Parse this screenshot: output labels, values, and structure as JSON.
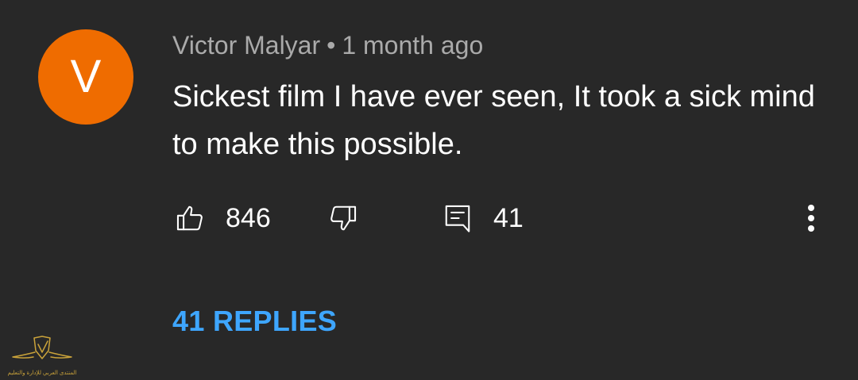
{
  "comment": {
    "avatar_letter": "V",
    "avatar_color": "#ef6c00",
    "author": "Victor Malyar",
    "separator": "•",
    "time": "1 month ago",
    "text": "Sickest film I have ever seen, It took a sick mind to make this possible.",
    "likes": "846",
    "reply_count": "41",
    "replies_link": "41 REPLIES",
    "link_color": "#3ea6ff"
  },
  "icons": {
    "like": "thumbs-up-icon",
    "dislike": "thumbs-down-icon",
    "reply": "comment-icon",
    "more": "more-vertical-icon"
  },
  "watermark": {
    "text": "المنتدى العربي للإدارة والتعليم"
  }
}
